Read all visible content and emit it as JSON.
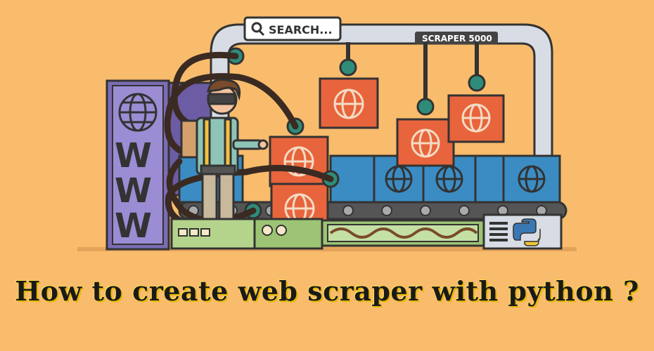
{
  "search_sign": {
    "label": "SEARCH...",
    "icon": "magnifier-icon"
  },
  "machine_plate": {
    "label": "SCRAPER 5000"
  },
  "www_panel": {
    "letters": [
      "W",
      "W",
      "W"
    ],
    "icon": "globe-icon"
  },
  "caption": {
    "text": "How to create web scraper with python  ?"
  },
  "colors": {
    "background": "#f8bc6c",
    "outline": "#333333",
    "crate_orange": "#e8643c",
    "crate_blue": "#3c8cc4",
    "panel_purple": "#7c6cb4",
    "claw_teal": "#2e8c78",
    "machine_grey": "#d8dce4",
    "panel_green": "#9cc474"
  }
}
